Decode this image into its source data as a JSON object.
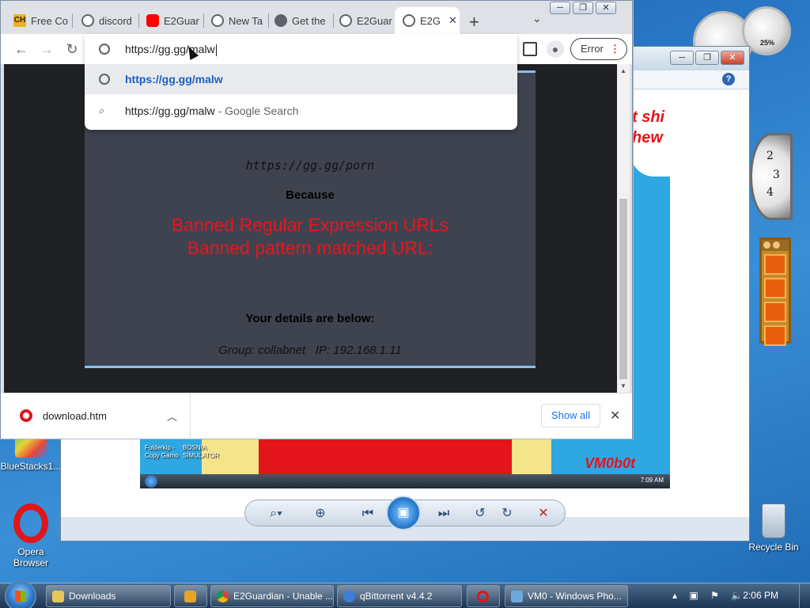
{
  "desktop": {
    "mem_gadget_pct": "25%",
    "clock_numbers": [
      "2",
      "3",
      "4"
    ],
    "icons": [
      {
        "label": "BlueStacks1..."
      },
      {
        "label": "Opera Browser"
      },
      {
        "label": "Recycle Bin"
      }
    ]
  },
  "photo_viewer": {
    "image_bubble_text": "t shi\nhew",
    "image_captions": [
      "Folderkip - Copy Gamo",
      "BOSNIA SIMULATOR"
    ],
    "image_brand": "VM0b0t",
    "image_time": "7:09 AM",
    "window_controls": [
      "─",
      "❐",
      "✕"
    ],
    "help_icon": "?",
    "toolbar_icons": [
      "zoom-icon",
      "fit-icon",
      "previous-icon",
      "slideshow-icon",
      "next-icon",
      "rotate-left-icon",
      "rotate-right-icon",
      "delete-icon"
    ]
  },
  "chrome": {
    "tabs": [
      {
        "label": "Free Co",
        "icon": "ch-icon"
      },
      {
        "label": "discord",
        "icon": "globe-icon"
      },
      {
        "label": "E2Guar",
        "icon": "youtube-icon"
      },
      {
        "label": "New Ta",
        "icon": "chrome-icon"
      },
      {
        "label": "Get the",
        "icon": "wordpress-icon"
      },
      {
        "label": "E2Guar",
        "icon": "globe-icon"
      },
      {
        "label": "E2G",
        "icon": "globe-icon",
        "active": true
      }
    ],
    "window_controls": [
      "─",
      "❐",
      "✕"
    ],
    "omnibox": {
      "text": "https://gg.gg/malw",
      "suggestions": [
        {
          "text": "https://gg.gg/malw",
          "icon": "globe-icon"
        },
        {
          "text": "https://gg.gg/malw",
          "hint": " - Google Search",
          "icon": "search-icon"
        }
      ]
    },
    "toolbar": {
      "error_label": "Error"
    },
    "page": {
      "blocked_url": "https://gg.gg/porn",
      "because": "Because",
      "reason_line1": "Banned Regular Expression URLs",
      "reason_line2": "Banned pattern matched URL:",
      "details_heading": "Your details are below:",
      "group_line": "Group: collabnet   IP: 192.168.1.11"
    },
    "download_bar": {
      "file_name": "download.htm",
      "show_all_label": "Show all"
    }
  },
  "taskbar": {
    "tasks": [
      {
        "label": "Downloads"
      },
      {
        "label": ""
      },
      {
        "label": "E2Guardian - Unable ..."
      },
      {
        "label": "qBittorrent v4.4.2"
      },
      {
        "label": ""
      },
      {
        "label": "VM0 - Windows Pho..."
      }
    ],
    "clock": "2:06 PM"
  },
  "colors": {
    "banned_red": "#e8141c",
    "card_bg": "#3f4350",
    "link_blue": "#1a73e8"
  }
}
